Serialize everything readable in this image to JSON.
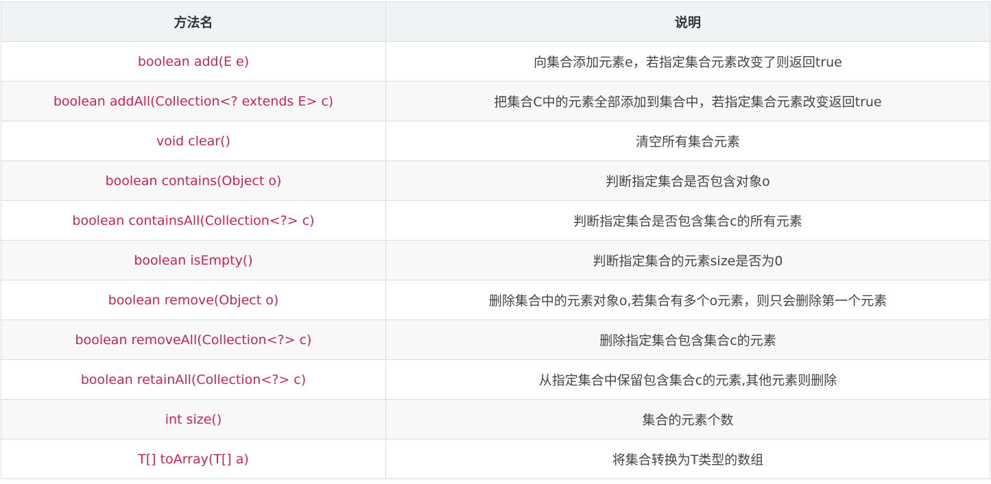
{
  "table": {
    "headers": [
      "方法名",
      "说明"
    ],
    "rows": [
      {
        "method": "boolean add(E e)",
        "desc": "向集合添加元素e，若指定集合元素改变了则返回true"
      },
      {
        "method": "boolean addAll(Collection<? extends E> c)",
        "desc": "把集合C中的元素全部添加到集合中，若指定集合元素改变返回true"
      },
      {
        "method": "void clear()",
        "desc": "清空所有集合元素"
      },
      {
        "method": "boolean contains(Object o)",
        "desc": "判断指定集合是否包含对象o"
      },
      {
        "method": "boolean containsAll(Collection<?> c)",
        "desc": "判断指定集合是否包含集合c的所有元素"
      },
      {
        "method": "boolean isEmpty()",
        "desc": "判断指定集合的元素size是否为0"
      },
      {
        "method": "boolean remove(Object o)",
        "desc": "删除集合中的元素对象o,若集合有多个o元素，则只会删除第一个元素"
      },
      {
        "method": "boolean removeAll(Collection<?> c)",
        "desc": "删除指定集合包含集合c的元素"
      },
      {
        "method": "boolean retainAll(Collection<?> c)",
        "desc": "从指定集合中保留包含集合c的元素,其他元素则删除"
      },
      {
        "method": "int size()",
        "desc": "集合的元素个数"
      },
      {
        "method": "T[] toArray(T[] a)",
        "desc": "将集合转换为T类型的数组"
      }
    ]
  },
  "colors": {
    "header_bg": "#eff3f5",
    "method_text": "#c7254e",
    "desc_text": "#444444",
    "border": "#dddddd",
    "stripe": "#f8f8f8"
  }
}
